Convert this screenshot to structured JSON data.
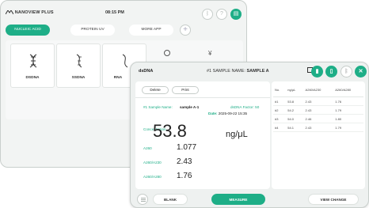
{
  "back": {
    "brand": "NANOVIEW PLUS",
    "time": "08:15 PM",
    "tabs": [
      "NUCLEIC ACID",
      "PROTEIN UV",
      "MORE APP"
    ],
    "tiles": [
      "DSDNA",
      "SSDNA",
      "RNA"
    ]
  },
  "front": {
    "title": "dsDNA",
    "sample_prefix": "#1 SAMPLE NAME: ",
    "sample_name": "SAMPLE A",
    "delete_label": "Delete",
    "print_label": "Print",
    "sample_field_label": "#1 Sample Name:",
    "sample_field_value": "sample A-1",
    "factor_label": "dsDNA  Factor: 50",
    "date_label": "Date:",
    "date_value": "2025-09-22 15:35",
    "concentration_label": "Concentration",
    "concentration_value": "53.8",
    "concentration_unit": "ng/μL",
    "metrics": [
      {
        "label": "A260",
        "value": "1.077"
      },
      {
        "label": "A260/A230",
        "value": "2.43"
      },
      {
        "label": "A260/A280",
        "value": "1.76"
      }
    ],
    "table": {
      "headers": [
        "No.",
        "ng/μL",
        "A260/A230",
        "A260/A280"
      ],
      "rows": [
        [
          "#1",
          "53.8",
          "2.43",
          "1.76"
        ],
        [
          "#2",
          "54.2",
          "2.43",
          "1.79"
        ],
        [
          "#3",
          "54.0",
          "2.46",
          "1.80"
        ],
        [
          "#4",
          "54.1",
          "2.43",
          "1.79"
        ]
      ]
    },
    "blank_label": "BLANK",
    "measure_label": "MEASURE",
    "view_change_label": "VIEW CHANGE"
  },
  "colors": {
    "accent": "#1eae87"
  }
}
